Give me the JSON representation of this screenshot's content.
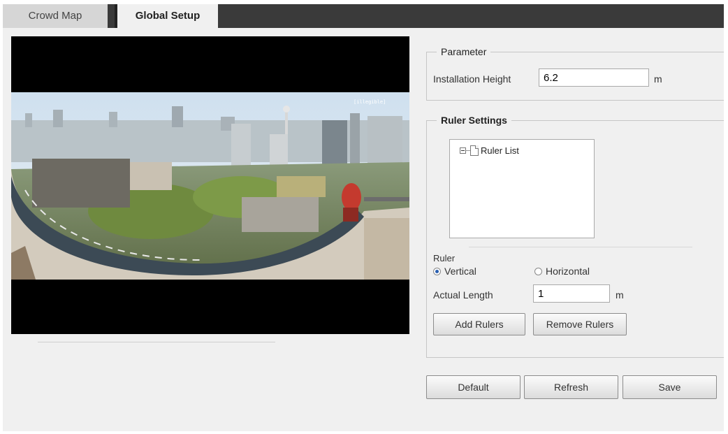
{
  "tabs": [
    {
      "label": "Crowd Map",
      "active": false
    },
    {
      "label": "Global Setup",
      "active": true
    }
  ],
  "video": {
    "overlay_text": "[illegible]"
  },
  "parameter": {
    "legend": "Parameter",
    "installation_height_label": "Installation Height",
    "installation_height_value": "6.2",
    "unit": "m"
  },
  "ruler_settings": {
    "legend": "Ruler Settings",
    "tree_root_label": "Ruler List",
    "ruler_label": "Ruler",
    "orientation_options": [
      {
        "label": "Vertical",
        "selected": true
      },
      {
        "label": "Horizontal",
        "selected": false
      }
    ],
    "actual_length_label": "Actual Length",
    "actual_length_value": "1",
    "unit": "m",
    "add_button": "Add Rulers",
    "remove_button": "Remove Rulers"
  },
  "footer_buttons": {
    "default": "Default",
    "refresh": "Refresh",
    "save": "Save"
  },
  "colors": {
    "tab_bar": "#3a3a3a",
    "panel_bg": "#f0f0f0",
    "radio_accent": "#2a5fb0"
  }
}
